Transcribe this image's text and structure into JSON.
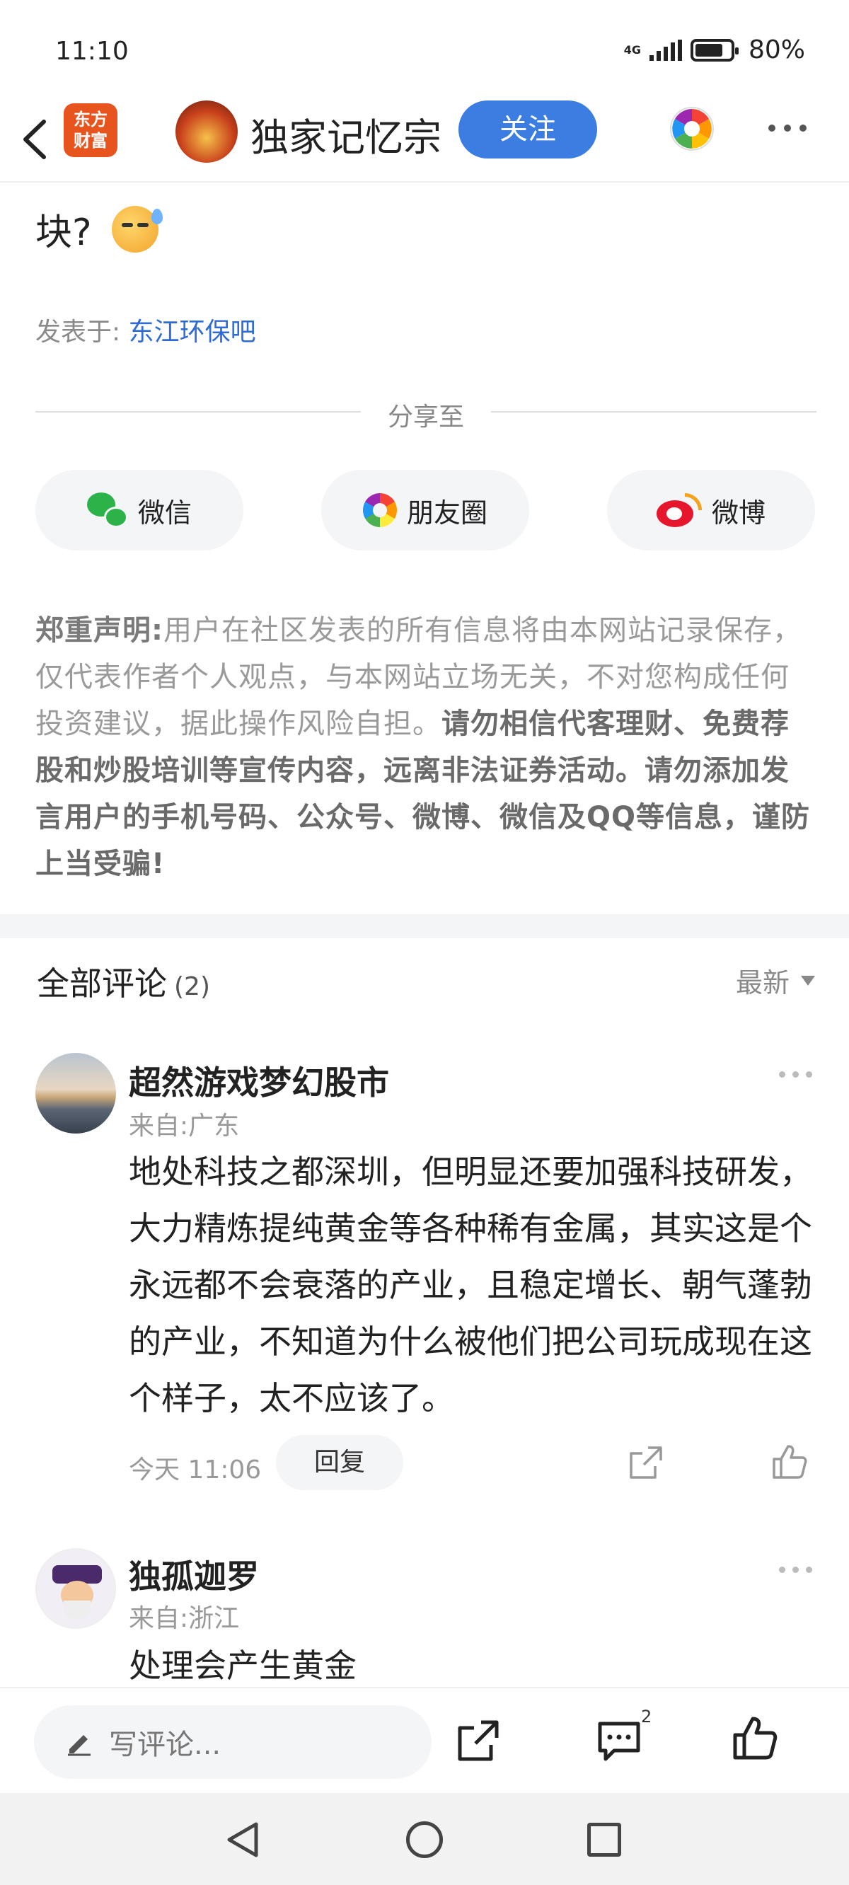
{
  "status_bar": {
    "time": "11:10",
    "network": "4G",
    "battery": "80%",
    "battery_level": 0.8
  },
  "header": {
    "logo_text_1": "东方",
    "logo_text_2": "财富",
    "author": "独家记忆宗",
    "follow_label": "关注"
  },
  "article": {
    "tail_text": "块?",
    "posted_in_prefix": "发表于:",
    "posted_in_forum": "东江环保吧"
  },
  "share": {
    "title": "分享至",
    "buttons": [
      {
        "label": "微信",
        "icon": "wechat-icon"
      },
      {
        "label": "朋友圈",
        "icon": "moments-icon"
      },
      {
        "label": "微博",
        "icon": "weibo-icon"
      }
    ]
  },
  "disclaimer": {
    "title": "郑重声明:",
    "body": "用户在社区发表的所有信息将由本网站记录保存，仅代表作者个人观点，与本网站立场无关，不对您构成任何投资建议，据此操作风险自担。",
    "warning": "请勿相信代客理财、免费荐股和炒股培训等宣传内容，远离非法证券活动。请勿添加发言用户的手机号码、公众号、微博、微信及QQ等信息，谨防上当受骗!"
  },
  "comments": {
    "title": "全部评论",
    "count": "(2)",
    "sort_label": "最新",
    "items": [
      {
        "user": "超然游戏梦幻股市",
        "location": "来自:广东",
        "body": "地处科技之都深圳，但明显还要加强科技研发，大力精炼提纯黄金等各种稀有金属，其实这是个永远都不会衰落的产业，且稳定增长、朝气蓬勃的产业，不知道为什么被他们把公司玩成现在这个样子，太不应该了。",
        "time": "今天 11:06",
        "reply_label": "回复"
      },
      {
        "user": "独孤迦罗",
        "location": "来自:浙江",
        "body": "处理会产生黄金"
      }
    ]
  },
  "bottom_bar": {
    "input_placeholder": "写评论...",
    "comment_count": "2"
  }
}
